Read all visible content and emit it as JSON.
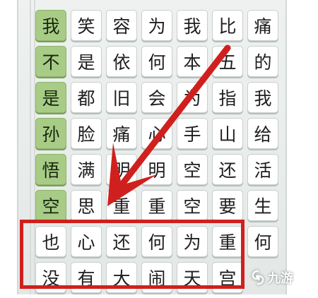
{
  "game": {
    "grid": [
      [
        "我",
        "笑",
        "容",
        "为",
        "我",
        "比",
        "痛"
      ],
      [
        "不",
        "是",
        "依",
        "何",
        "本",
        "五",
        "的"
      ],
      [
        "是",
        "都",
        "旧",
        "会",
        "为",
        "指",
        "我"
      ],
      [
        "孙",
        "脸",
        "痛",
        "心",
        "手",
        "山",
        "给"
      ],
      [
        "悟",
        "满",
        "明",
        "明",
        "空",
        "还",
        "活"
      ],
      [
        "空",
        "思",
        "重",
        "重",
        "空",
        "要",
        "生"
      ],
      [
        "也",
        "心",
        "还",
        "何",
        "为",
        "重",
        "何"
      ],
      [
        "没",
        "有",
        "大",
        "闹",
        "天",
        "宫",
        ""
      ]
    ],
    "selected_cells": [
      [
        0,
        0
      ],
      [
        1,
        0
      ],
      [
        2,
        0
      ],
      [
        3,
        0
      ],
      [
        4,
        0
      ],
      [
        5,
        0
      ]
    ],
    "highlight_color": "#d0201d",
    "selected_color": "#a8cc86"
  },
  "watermark": {
    "icon": "jiuyou-swirl-logo",
    "text": "九游"
  }
}
